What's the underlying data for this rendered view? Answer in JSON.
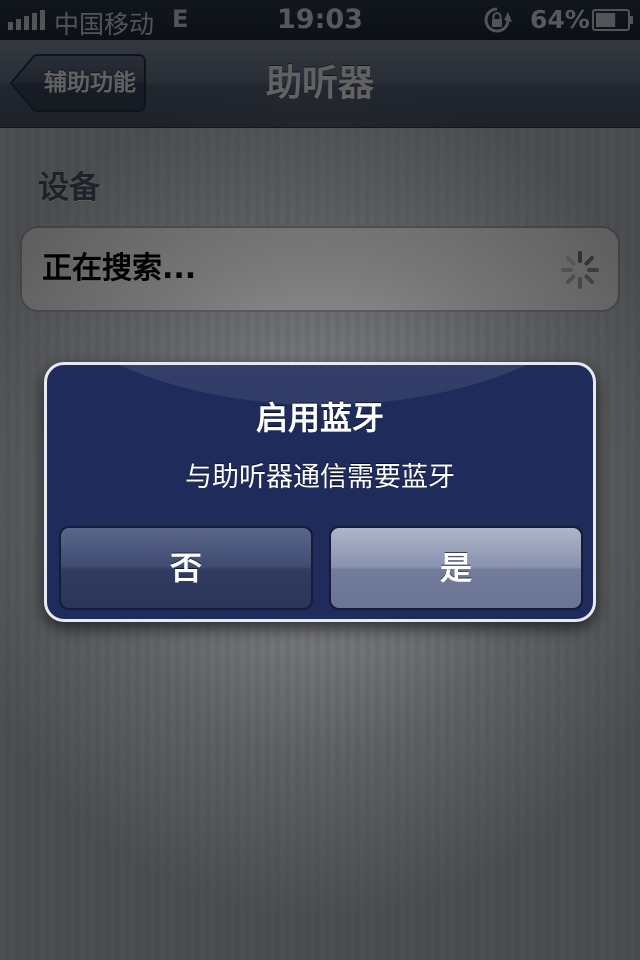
{
  "status_bar": {
    "carrier": "中国移动",
    "network": "E",
    "time": "19:03",
    "battery_percent": "64%",
    "battery_level": 0.64,
    "signal_bars": 5
  },
  "nav_bar": {
    "back_label": "辅助功能",
    "title": "助听器"
  },
  "content": {
    "section_header": "设备",
    "searching_label": "正在搜索..."
  },
  "alert": {
    "title": "启用蓝牙",
    "message": "与助听器通信需要蓝牙",
    "no_label": "否",
    "yes_label": "是"
  },
  "colors": {
    "nav_tint": "#6d7990",
    "alert_background": "#1f2b5a"
  }
}
